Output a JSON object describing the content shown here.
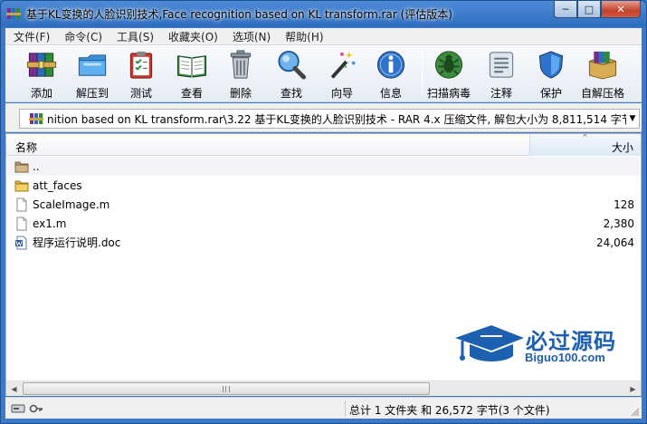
{
  "window": {
    "title": "基于KL变换的人脸识别技术,Face recognition based on KL transform.rar (评估版本)",
    "min_glyph": "─",
    "max_glyph": "□",
    "close_glyph": "✕"
  },
  "menu": {
    "items": [
      {
        "label": "文件(F)"
      },
      {
        "label": "命令(C)"
      },
      {
        "label": "工具(S)"
      },
      {
        "label": "收藏夹(O)"
      },
      {
        "label": "选项(N)"
      },
      {
        "label": "帮助(H)"
      }
    ]
  },
  "toolbar": {
    "buttons": [
      {
        "label": "添加",
        "icon": "winrar-books-icon"
      },
      {
        "label": "解压到",
        "icon": "folder-extract-icon"
      },
      {
        "label": "测试",
        "icon": "clipboard-check-icon"
      },
      {
        "label": "查看",
        "icon": "open-book-icon"
      },
      {
        "label": "删除",
        "icon": "trash-can-icon"
      },
      {
        "label": "查找",
        "icon": "magnifier-icon"
      },
      {
        "label": "向导",
        "icon": "magic-wand-icon"
      },
      {
        "label": "信息",
        "icon": "info-icon"
      },
      {
        "label": "扫描病毒",
        "icon": "virus-scan-icon"
      },
      {
        "label": "注释",
        "icon": "comment-icon"
      },
      {
        "label": "保护",
        "icon": "shield-icon"
      },
      {
        "label": "自解压格",
        "icon": "sfx-box-icon"
      }
    ]
  },
  "address": {
    "path": "nition based on KL transform.rar\\3.22  基于KL变换的人脸识别技术 - RAR 4.x 压缩文件, 解包大小为 8,811,514 字节",
    "dropdown_glyph": "▼"
  },
  "columns": {
    "name": "名称",
    "size": "大小",
    "sort_glyph": "^"
  },
  "files": [
    {
      "name": "..",
      "size": "",
      "icon": "parent-folder-icon"
    },
    {
      "name": "att_faces",
      "size": "",
      "icon": "folder-icon"
    },
    {
      "name": "ScaleImage.m",
      "size": "128",
      "icon": "file-icon"
    },
    {
      "name": "ex1.m",
      "size": "2,380",
      "icon": "file-icon"
    },
    {
      "name": "程序运行说明.doc",
      "size": "24,064",
      "icon": "word-doc-icon"
    }
  ],
  "scrollbar": {
    "left_glyph": "◀",
    "right_glyph": "▶"
  },
  "watermark": {
    "title": "必过源码",
    "url": "Biguo100.com"
  },
  "status": {
    "text": "总计 1 文件夹 和 26,572 字节(3 个文件)"
  },
  "colors": {
    "accent": "#1d5fb0",
    "title_bar": "#3a78c4"
  }
}
